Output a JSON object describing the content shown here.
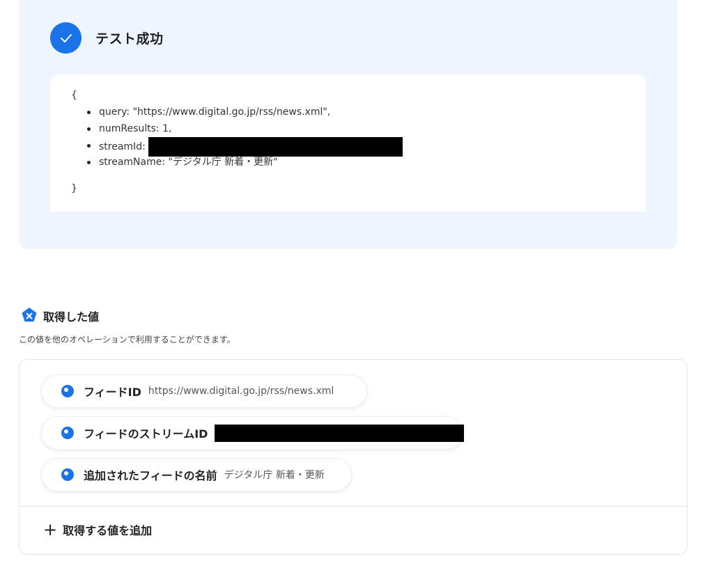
{
  "test_result": {
    "title": "テスト成功",
    "brace_open": "{",
    "brace_close": "}",
    "lines": {
      "query": "query: \"https://www.digital.go.jp/rss/news.xml\",",
      "num_results": "numResults: 1,",
      "stream_id_key": "streamId:",
      "stream_name": "streamName: \"デジタル庁 新着・更新\""
    }
  },
  "acquired": {
    "title": "取得した値",
    "description": "この値を他のオペレーションで利用することができます。",
    "items": [
      {
        "label": "フィードID",
        "value": "https://www.digital.go.jp/rss/news.xml"
      },
      {
        "label": "フィードのストリームID",
        "value": ""
      },
      {
        "label": "追加されたフィードの名前",
        "value": "デジタル庁 新着・更新"
      }
    ],
    "add_label": "取得する値を追加"
  },
  "colors": {
    "accent": "#1a73e8",
    "panel_bg": "#eef5fe"
  },
  "icons": {
    "success": "check-icon",
    "section": "x-badge-icon",
    "item": "dot-icon",
    "add": "plus-icon"
  }
}
